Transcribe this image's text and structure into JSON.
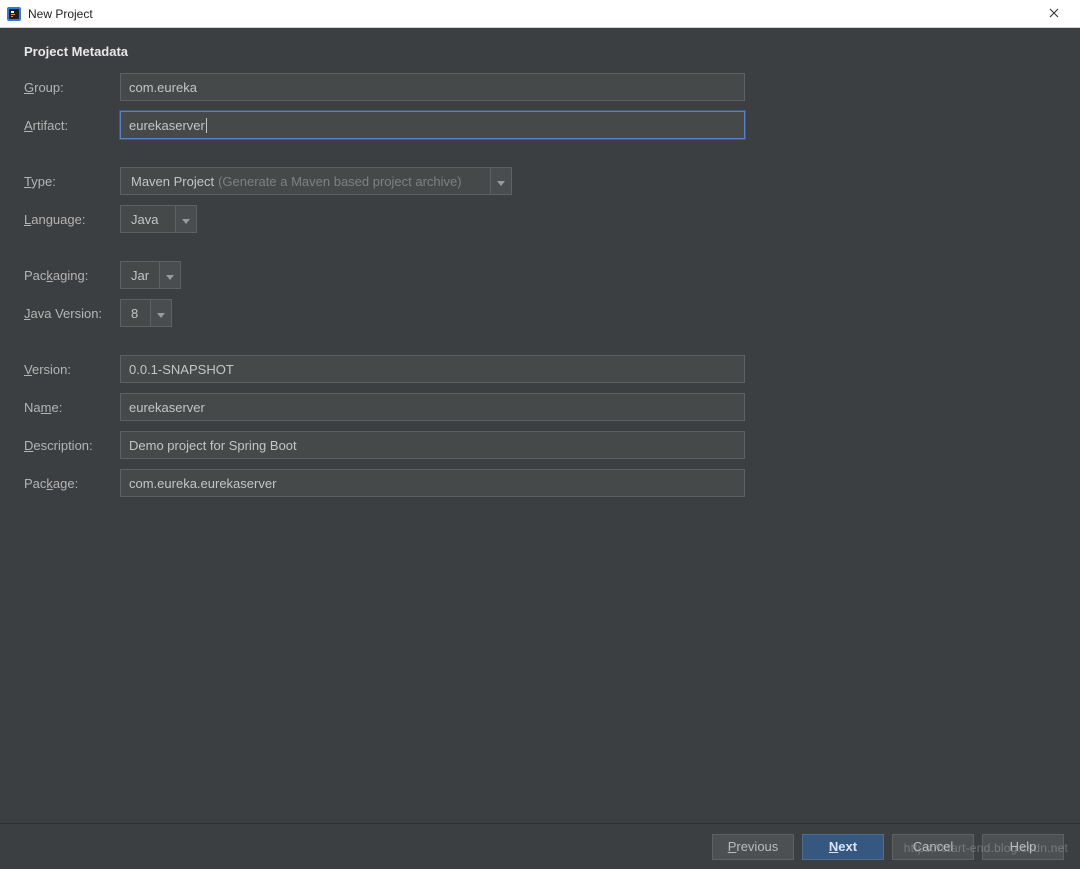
{
  "window": {
    "title": "New Project"
  },
  "section": {
    "title": "Project Metadata"
  },
  "labels": {
    "group": "roup:",
    "group_mn": "G",
    "artifact": "rtifact:",
    "artifact_mn": "A",
    "type": "ype:",
    "type_mn": "T",
    "language": "anguage:",
    "language_mn": "L",
    "packaging_pre": "Pac",
    "packaging_mn": "k",
    "packaging_post": "aging:",
    "java_version": "ava Version:",
    "java_version_mn": "J",
    "version": "ersion:",
    "version_mn": "V",
    "name_pre": "Na",
    "name_mn": "m",
    "name_post": "e:",
    "description": "escription:",
    "description_mn": "D",
    "package_pre": "Pac",
    "package_mn": "k",
    "package_post": "age:"
  },
  "fields": {
    "group": "com.eureka",
    "artifact": "eurekaserver",
    "type": "Maven Project",
    "type_hint": "(Generate a Maven based project archive)",
    "language": "Java",
    "packaging": "Jar",
    "java_version": "8",
    "version": "0.0.1-SNAPSHOT",
    "name": "eurekaserver",
    "description": "Demo project for Spring Boot",
    "package": "com.eureka.eurekaserver"
  },
  "buttons": {
    "previous": "revious",
    "previous_mn": "P",
    "next": "ext",
    "next_mn": "N",
    "cancel": "Cancel",
    "help": "Help"
  },
  "watermark": "https://start-end.blog.csdn.net"
}
